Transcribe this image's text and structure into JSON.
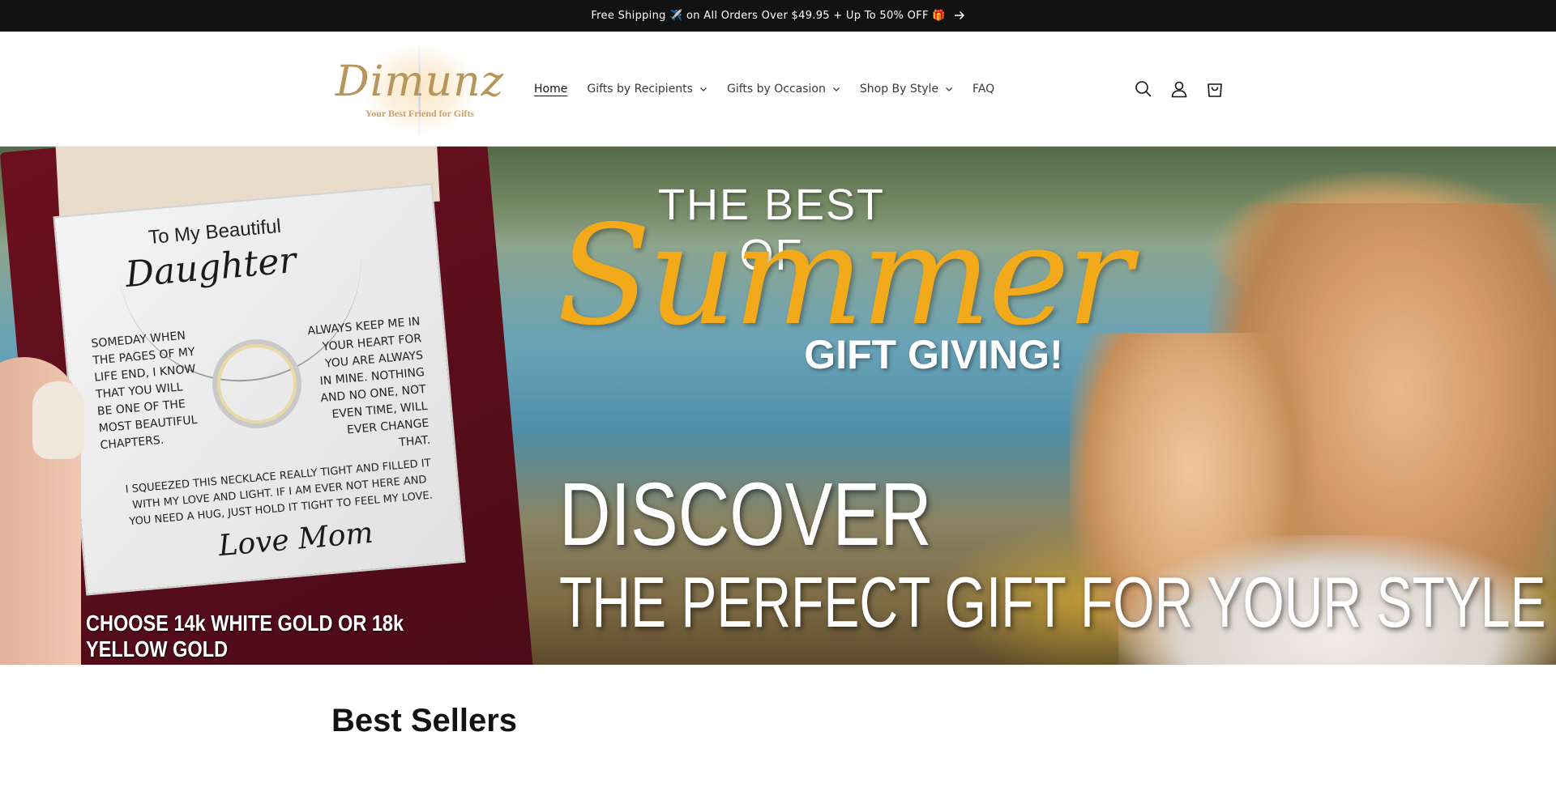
{
  "announcement": {
    "text": "Free Shipping ✈️ on All Orders Over $49.95 + Up To 50% OFF 🎁",
    "arrow_icon": "arrow-right-icon"
  },
  "header": {
    "logo": {
      "name": "Dimunz",
      "tagline": "Your Best Friend for Gifts"
    },
    "nav": [
      {
        "label": "Home",
        "active": true,
        "dropdown": false
      },
      {
        "label": "Gifts by Recipients",
        "active": false,
        "dropdown": true
      },
      {
        "label": "Gifts by Occasion",
        "active": false,
        "dropdown": true
      },
      {
        "label": "Shop By Style",
        "active": false,
        "dropdown": true
      },
      {
        "label": "FAQ",
        "active": false,
        "dropdown": false
      }
    ],
    "icons": [
      "search-icon",
      "account-icon",
      "cart-icon"
    ]
  },
  "hero": {
    "headline_small": "THE BEST OF",
    "headline_script": "Summer",
    "headline_sub": "GIFT GIVING!",
    "discover": "DISCOVER",
    "perfect": "THE PERFECT GIFT FOR YOUR STYLE",
    "choose": "CHOOSE 14k WHITE GOLD OR 18k YELLOW GOLD",
    "card": {
      "title_small": "To My Beautiful",
      "title_big": "Daughter",
      "left_text": "SOMEDAY WHEN THE PAGES OF MY LIFE END, I KNOW THAT YOU WILL BE ONE OF THE MOST BEAUTIFUL CHAPTERS.",
      "right_text": "ALWAYS KEEP ME IN YOUR HEART FOR YOU ARE ALWAYS IN MINE. NOTHING AND NO ONE, NOT EVEN TIME, WILL EVER CHANGE THAT.",
      "bottom_text": "I SQUEEZED THIS NECKLACE REALLY TIGHT AND FILLED IT WITH MY LOVE AND LIGHT. IF I AM EVER NOT HERE AND YOU NEED A HUG, JUST HOLD IT TIGHT TO FEEL MY LOVE.",
      "signature": "Love Mom"
    }
  },
  "main": {
    "section_title": "Best Sellers"
  },
  "colors": {
    "announcement_bg": "#121212",
    "summer_accent": "#f2a91a",
    "logo_gold": "#b8955a"
  }
}
